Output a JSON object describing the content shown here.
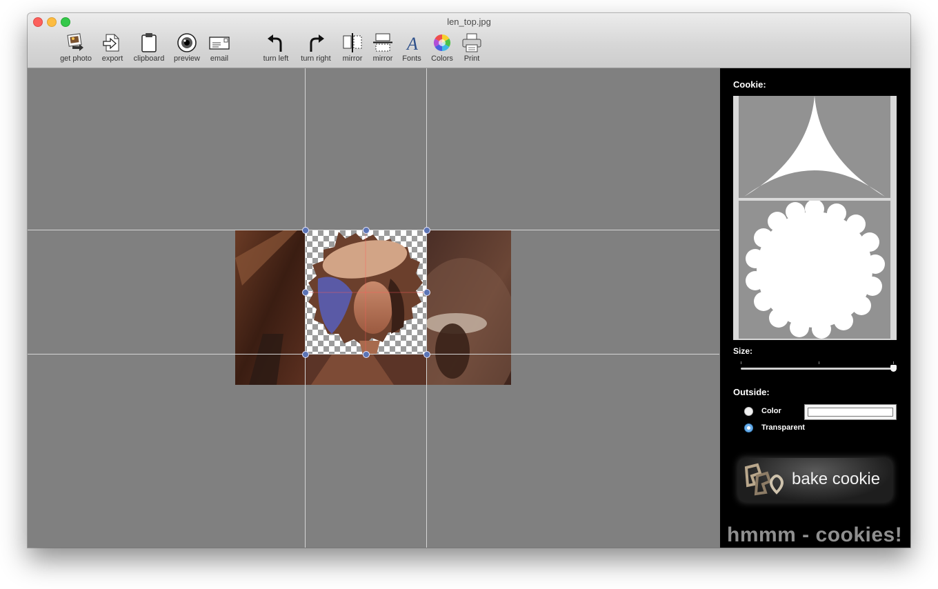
{
  "window": {
    "title": "len_top.jpg"
  },
  "toolbar": {
    "items": [
      {
        "label": "get photo",
        "icon": "get-photo-icon"
      },
      {
        "label": "export",
        "icon": "export-icon"
      },
      {
        "label": "clipboard",
        "icon": "clipboard-icon"
      },
      {
        "label": "preview",
        "icon": "eye-icon"
      },
      {
        "label": "email",
        "icon": "envelope-icon"
      },
      {
        "label": "turn left",
        "icon": "rotate-left-icon"
      },
      {
        "label": "turn right",
        "icon": "rotate-right-icon"
      },
      {
        "label": "mirror",
        "icon": "mirror-horizontal-icon"
      },
      {
        "label": "mirror",
        "icon": "mirror-vertical-icon"
      },
      {
        "label": "Fonts",
        "icon": "fonts-icon"
      },
      {
        "label": "Colors",
        "icon": "color-wheel-icon"
      },
      {
        "label": "Print",
        "icon": "printer-icon"
      }
    ]
  },
  "sidebar": {
    "cookie_label": "Cookie:",
    "size_label": "Size:",
    "size_value": 1.0,
    "outside_label": "Outside:",
    "outside_options": [
      {
        "label": "Color",
        "selected": false
      },
      {
        "label": "Transparent",
        "selected": true
      }
    ],
    "bake_button": "bake cookie",
    "slogan": "hmmm - cookies!"
  },
  "colors": {
    "canvas_bg": "#808080",
    "sidebar_bg": "#000000",
    "handle": "#5b74b5"
  }
}
